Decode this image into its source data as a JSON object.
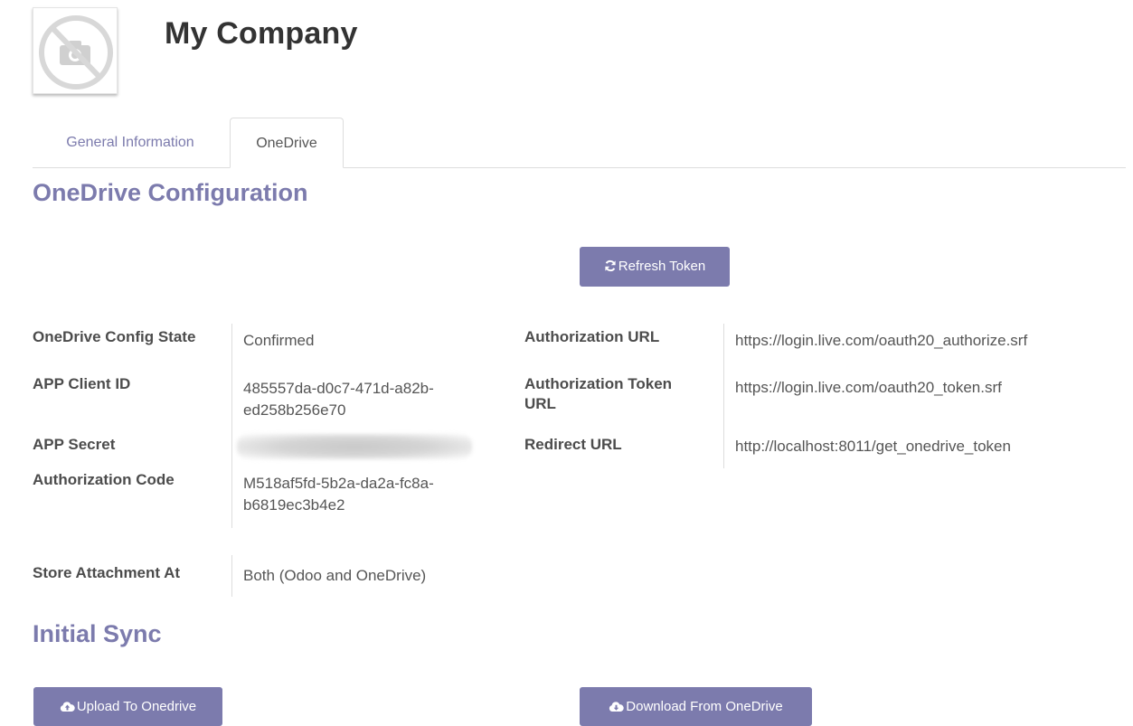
{
  "company": {
    "name": "My Company",
    "avatar_icon": "camera-placeholder-icon"
  },
  "tabs": [
    {
      "label": "General Information",
      "active": false
    },
    {
      "label": "OneDrive",
      "active": true
    }
  ],
  "onedrive_config": {
    "title": "OneDrive Configuration",
    "refresh_button": {
      "label": "Refresh Token",
      "icon": "refresh-icon"
    },
    "fields_left": [
      {
        "label": "OneDrive Config State",
        "value": "Confirmed"
      },
      {
        "label": "APP Client ID",
        "value": "485557da-d0c7-471d-a82b-ed258b256e70"
      },
      {
        "label": "APP Secret",
        "value": ""
      },
      {
        "label": "Authorization Code",
        "value": "M518af5fd-5b2a-da2a-fc8a-b6819ec3b4e2"
      }
    ],
    "fields_right": [
      {
        "label": "Authorization URL",
        "value": "https://login.live.com/oauth20_authorize.srf"
      },
      {
        "label": "Authorization Token URL",
        "value": "https://login.live.com/oauth20_token.srf"
      },
      {
        "label": "Redirect URL",
        "value": "http://localhost:8011/get_onedrive_token"
      }
    ],
    "store_attachment": {
      "label": "Store Attachment At",
      "value": "Both (Odoo and OneDrive)"
    }
  },
  "initial_sync": {
    "title": "Initial Sync",
    "upload_button": {
      "label": "Upload To Onedrive",
      "icon": "cloud-upload-icon"
    },
    "download_button": {
      "label": "Download From OneDrive",
      "icon": "cloud-download-icon"
    }
  },
  "colors": {
    "accent": "#7c7bad",
    "text": "#4c4c4c",
    "border": "#dddddd"
  }
}
